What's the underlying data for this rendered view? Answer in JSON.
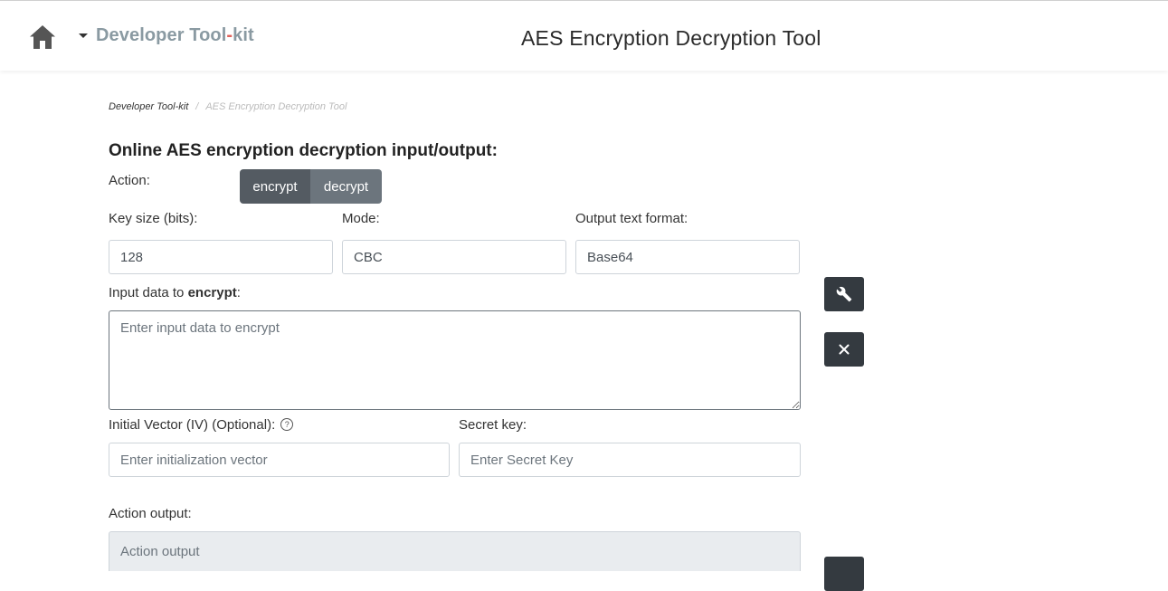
{
  "header": {
    "brand_prefix": "Developer Tool",
    "brand_dash": "-",
    "brand_suffix": "kit",
    "title": "AES Encryption Decryption Tool"
  },
  "breadcrumb": {
    "home": "Developer Tool-kit",
    "separator": "/",
    "current": "AES Encryption Decryption Tool"
  },
  "form": {
    "section_title": "Online AES encryption decryption input/output:",
    "action_label": "Action:",
    "action_options": [
      "encrypt",
      "decrypt"
    ],
    "selected_action": "encrypt",
    "key_size_label": "Key size (bits):",
    "key_size_value": "128",
    "mode_label": "Mode:",
    "mode_value": "CBC",
    "output_format_label": "Output text format:",
    "output_format_value": "Base64",
    "input_label_prefix": "Input data to ",
    "input_label_action": "encrypt",
    "input_label_suffix": ":",
    "input_placeholder": "Enter input data to encrypt",
    "iv_label": "Initial Vector (IV) (Optional):",
    "iv_help": "?",
    "iv_placeholder": "Enter initialization vector",
    "secret_label": "Secret key:",
    "secret_placeholder": "Enter Secret Key",
    "output_label": "Action output:",
    "output_placeholder": "Action output"
  },
  "icons": {
    "home": "home-icon",
    "tools": "wrench-icon",
    "clear": "close-icon"
  },
  "colors": {
    "brand_text": "#8a9aa2",
    "brand_accent": "#e0625c",
    "button_dark": "#343a40",
    "segment_active": "#545b62",
    "segment_inactive": "#6c757d"
  }
}
